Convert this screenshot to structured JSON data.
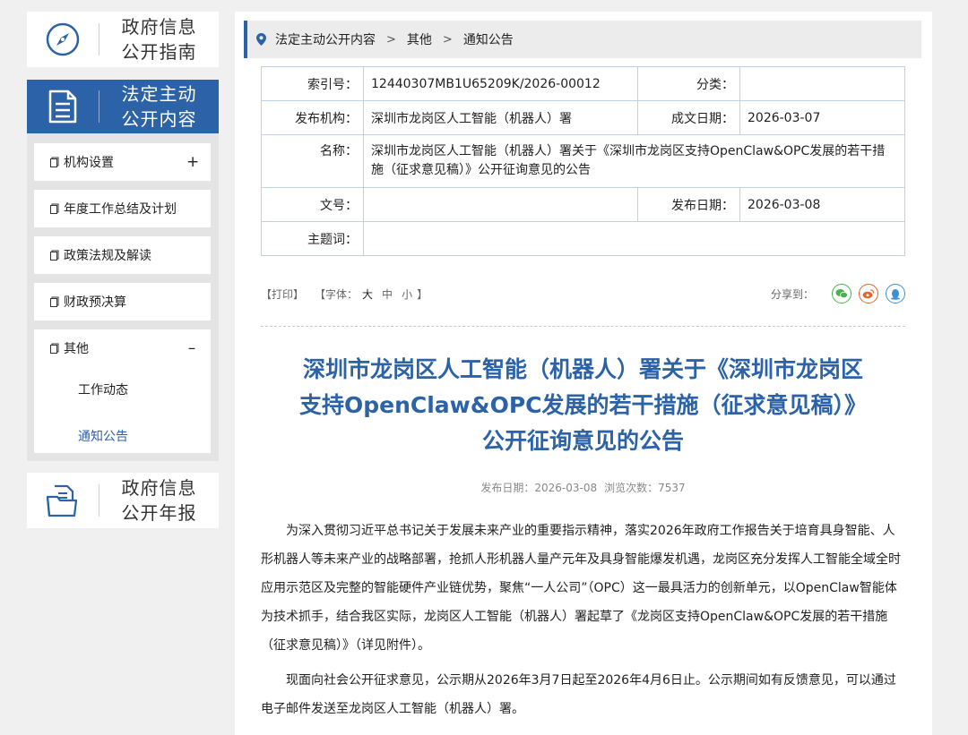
{
  "left": {
    "guide": {
      "line1": "政府信息",
      "line2": "公开指南",
      "icon": "compass-icon"
    },
    "legal": {
      "line1": "法定主动",
      "line2": "公开内容",
      "icon": "document-icon",
      "items": [
        {
          "label": "机构设置",
          "toggle": "+"
        },
        {
          "label": "年度工作总结及计划"
        },
        {
          "label": "政策法规及解读"
        },
        {
          "label": "财政预决算"
        },
        {
          "label": "其他",
          "toggle": "–",
          "subs": [
            "工作动态",
            "通知公告"
          ]
        }
      ]
    },
    "annual": {
      "line1": "政府信息",
      "line2": "公开年报",
      "icon": "folder-icon"
    }
  },
  "breadcrumb": {
    "items": [
      "法定主动公开内容",
      "其他",
      "通知公告"
    ],
    "separator": ">"
  },
  "meta": {
    "index_label": "索引号：",
    "index_value": "12440307MB1U65209K/2026-00012",
    "category_label": "分类：",
    "category_value": "",
    "publisher_label": "发布机构：",
    "publisher_value": "深圳市龙岗区人工智能（机器人）署",
    "created_label": "成文日期：",
    "created_value": "2026-03-07",
    "name_label": "名称：",
    "name_value": "深圳市龙岗区人工智能（机器人）署关于《深圳市龙岗区支持OpenClaw&OPC发展的若干措施（征求意见稿）》公开征询意见的公告",
    "docno_label": "文号：",
    "docno_value": "",
    "pubdate_label": "发布日期：",
    "pubdate_value": "2026-03-08",
    "subject_label": "主题词：",
    "subject_value": ""
  },
  "tools": {
    "print": "【打印】",
    "font_prefix": "【字体：",
    "font_large": "大",
    "font_medium": "中",
    "font_small": "小",
    "font_suffix": "】",
    "share_label": "分享到："
  },
  "article": {
    "title_line1": "深圳市龙岗区人工智能（机器人）署关于《深圳市龙岗区",
    "title_line2": "支持OpenClaw&OPC发展的若干措施（征求意见稿）》",
    "title_line3": "公开征询意见的公告",
    "date_text": "发布日期：2026-03-08",
    "views_text": "浏览次数：7537",
    "p1": "为深入贯彻习近平总书记关于发展未来产业的重要指示精神，落实2026年政府工作报告关于培育具身智能、人形机器人等未来产业的战略部署，抢抓人形机器人量产元年及具身智能爆发机遇，龙岗区充分发挥人工智能全域全时应用示范区及完整的智能硬件产业链优势，聚焦“一人公司”（OPC）这一最具活力的创新单元，以OpenClaw智能体为技术抓手，结合我区实际，龙岗区人工智能（机器人）署起草了《龙岗区支持OpenClaw&OPC发展的若干措施（征求意见稿）》（详见附件）。",
    "p2": "现面向社会公开征求意见，公示期从2026年3月7日起至2026年4月6日止。公示期间如有反馈意见，可以通过电子邮件发送至龙岗区人工智能（机器人）署。"
  },
  "colors": {
    "accent": "#2c62a8",
    "wechat": "#4caf50",
    "weibo": "#e0662c",
    "qq": "#3d8fd6"
  }
}
